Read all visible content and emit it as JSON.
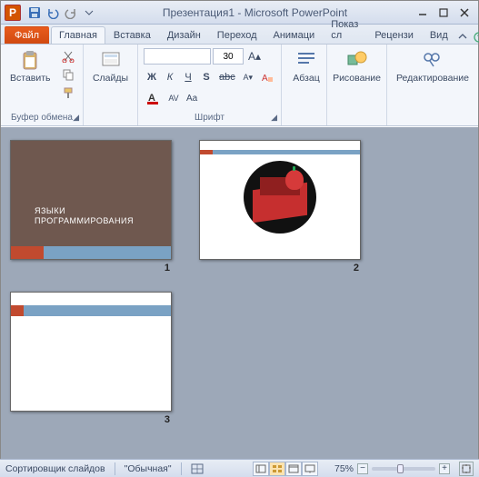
{
  "window": {
    "title": "Презентация1 - Microsoft PowerPoint",
    "app_letter": "P"
  },
  "qat": {
    "save": "save",
    "undo": "undo",
    "redo": "redo"
  },
  "tabs": {
    "file": "Файл",
    "home": "Главная",
    "insert": "Вставка",
    "design": "Дизайн",
    "transitions": "Переход",
    "animations": "Анимаци",
    "slideshow": "Показ сл",
    "review": "Рецензи",
    "view": "Вид"
  },
  "ribbon": {
    "clipboard": {
      "label": "Буфер обмена",
      "paste": "Вставить"
    },
    "slides": {
      "label": "Слайды",
      "btn": "Слайды"
    },
    "font": {
      "label": "Шрифт",
      "size": "30",
      "bold": "Ж",
      "italic": "К",
      "under": "Ч",
      "strike": "S",
      "shadow": "abc",
      "grow": "A",
      "shrink": "A",
      "clear": "Aa",
      "spacing": "AV"
    },
    "paragraph": {
      "label": "Абзац",
      "btn": "Абзац"
    },
    "drawing": {
      "label": "Рисование",
      "btn": "Рисование"
    },
    "editing": {
      "label": "Редактирование",
      "btn": "Редактирование"
    }
  },
  "slides": [
    {
      "num": "1",
      "title_line1": "ЯЗЫКИ",
      "title_line2": "ПРОГРАММИРОВАНИЯ"
    },
    {
      "num": "2"
    },
    {
      "num": "3"
    }
  ],
  "status": {
    "mode": "Сортировщик слайдов",
    "theme": "\"Обычная\"",
    "zoom": "75%"
  }
}
